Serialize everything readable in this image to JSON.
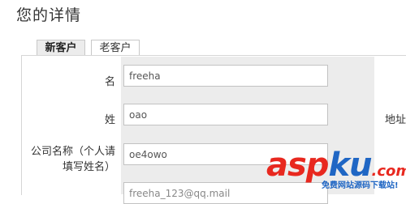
{
  "page": {
    "title": "您的详情"
  },
  "tabs": [
    {
      "label": "新客户",
      "active": true
    },
    {
      "label": "老客户",
      "active": false
    }
  ],
  "form": {
    "first_name": {
      "label": "名",
      "value": "freeha"
    },
    "last_name": {
      "label": "姓",
      "value": "oao"
    },
    "company": {
      "label_line1": "公司名称（个人请",
      "label_line2": "填写姓名）",
      "value": "oe4owo"
    },
    "email": {
      "value": "freeha_123@qq.mail"
    },
    "address": {
      "label": "地址"
    }
  },
  "watermark": {
    "brand_a": "asp",
    "brand_b": "ku",
    "brand_c": ".com",
    "subtitle": "免费网站源码下载站!",
    "colors": {
      "red": "#e8281f",
      "blue": "#1f66c4"
    }
  }
}
